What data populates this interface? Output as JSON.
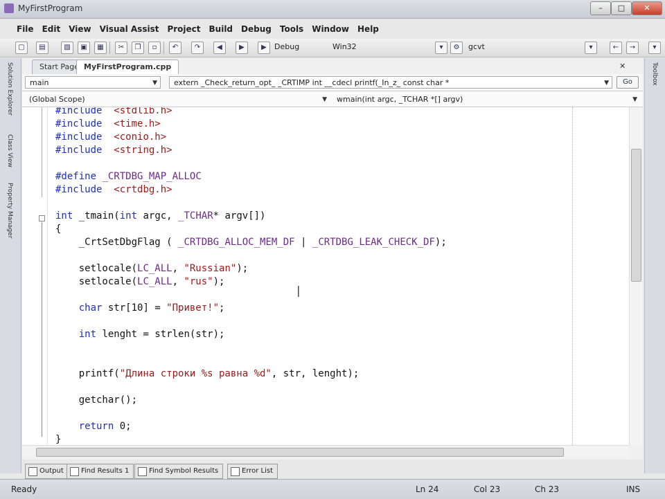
{
  "window": {
    "title": "MyFirstProgram"
  },
  "menu": [
    "File",
    "Edit",
    "View",
    "Visual Assist",
    "Project",
    "Build",
    "Debug",
    "Tools",
    "Window",
    "Help"
  ],
  "toolbar": {
    "config": "Debug",
    "platform": "Win32",
    "find": "gcvt"
  },
  "tabs": [
    "Start Page",
    "MyFirstProgram.cpp"
  ],
  "nav": {
    "scope_left": "main",
    "scope_right": "extern _Check_return_opt_ _CRTIMP int __cdecl printf(_In_z_ const char *",
    "class_combo": "(Global Scope)",
    "member_combo": "wmain(int argc, _TCHAR *[] argv)"
  },
  "code": [
    [
      [
        "kw",
        "#include"
      ],
      [
        "",
        "  "
      ],
      [
        "str",
        "<stdlib.h>"
      ]
    ],
    [
      [
        "kw",
        "#include"
      ],
      [
        "",
        "  "
      ],
      [
        "str",
        "<time.h>"
      ]
    ],
    [
      [
        "kw",
        "#include"
      ],
      [
        "",
        "  "
      ],
      [
        "str",
        "<conio.h>"
      ]
    ],
    [
      [
        "kw",
        "#include"
      ],
      [
        "",
        "  "
      ],
      [
        "str",
        "<string.h>"
      ]
    ],
    [],
    [
      [
        "kw",
        "#define"
      ],
      [
        "",
        " "
      ],
      [
        "mac",
        "_CRTDBG_MAP_ALLOC"
      ]
    ],
    [
      [
        "kw",
        "#include"
      ],
      [
        "",
        "  "
      ],
      [
        "str",
        "<crtdbg.h>"
      ]
    ],
    [],
    [
      [
        "kw",
        "int"
      ],
      [
        "",
        " _tmain("
      ],
      [
        "kw",
        "int"
      ],
      [
        "",
        " argc, "
      ],
      [
        "mac",
        "_TCHAR"
      ],
      [
        "",
        "* argv[])"
      ]
    ],
    [
      [
        "",
        "{"
      ]
    ],
    [
      [
        "",
        "    _CrtSetDbgFlag ( "
      ],
      [
        "mac",
        "_CRTDBG_ALLOC_MEM_DF"
      ],
      [
        "",
        " | "
      ],
      [
        "mac",
        "_CRTDBG_LEAK_CHECK_DF"
      ],
      [
        "",
        ");"
      ]
    ],
    [],
    [
      [
        "",
        "    setlocale("
      ],
      [
        "mac",
        "LC_ALL"
      ],
      [
        "",
        ", "
      ],
      [
        "str",
        "\"Russian\""
      ],
      [
        "",
        ");"
      ]
    ],
    [
      [
        "",
        "    setlocale("
      ],
      [
        "mac",
        "LC_ALL"
      ],
      [
        "",
        ", "
      ],
      [
        "str",
        "\"rus\""
      ],
      [
        "",
        ");"
      ]
    ],
    [],
    [
      [
        "kw",
        "    char"
      ],
      [
        "",
        " str[10] = "
      ],
      [
        "str",
        "\"Привет!\""
      ],
      [
        "",
        ";"
      ]
    ],
    [],
    [
      [
        "kw",
        "    int"
      ],
      [
        "",
        " lenght = strlen(str);"
      ]
    ],
    [],
    [],
    [
      [
        "",
        "    printf("
      ],
      [
        "str",
        "\"Длина строки %s равна %d\""
      ],
      [
        "",
        ", str, lenght);"
      ]
    ],
    [],
    [
      [
        "",
        "    getchar();"
      ]
    ],
    [],
    [
      [
        "kw",
        "    return"
      ],
      [
        "",
        " 0;"
      ]
    ],
    [
      [
        "",
        "}"
      ]
    ]
  ],
  "bottom_tabs": [
    "Output",
    "Find Results 1",
    "Find Symbol Results",
    "Error List"
  ],
  "left_panel": [
    "Solution Explorer",
    "Class View",
    "Property Manager"
  ],
  "right_panel": [
    "Toolbox"
  ],
  "status": {
    "ready": "Ready",
    "ln": "Ln 24",
    "col": "Col 23",
    "ch": "Ch 23",
    "ins": "INS"
  }
}
